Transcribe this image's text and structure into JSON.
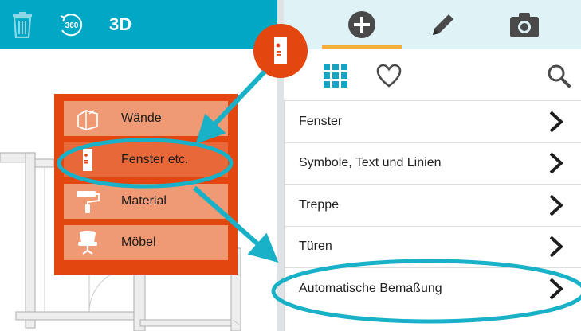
{
  "toolbar": {
    "trash_icon": "trash-icon",
    "view360_label": "360",
    "view3d_label": "3D"
  },
  "right_panel": {
    "tabs": [
      {
        "icon": "plus-circle-icon",
        "active": true
      },
      {
        "icon": "pencil-icon",
        "active": false
      },
      {
        "icon": "camera-icon",
        "active": false
      }
    ],
    "sub_icons": [
      "grid-icon",
      "heart-icon",
      "search-icon"
    ],
    "categories": [
      {
        "label": "Fenster"
      },
      {
        "label": "Symbole, Text und Linien"
      },
      {
        "label": "Treppe"
      },
      {
        "label": "Türen"
      },
      {
        "label": "Automatische Bemaßung"
      }
    ]
  },
  "mode_menu": {
    "items": [
      {
        "label": "Wände",
        "icon": "wall-icon"
      },
      {
        "label": "Fenster etc.",
        "icon": "window-door-icon",
        "active": true
      },
      {
        "label": "Material",
        "icon": "paint-roller-icon"
      },
      {
        "label": "Möbel",
        "icon": "chair-icon"
      }
    ]
  },
  "colors": {
    "top_bar": "#00a8c6",
    "accent_orange": "#e4460f",
    "annotation_teal": "#18b1c7",
    "active_tab_underline": "#f6b03a"
  }
}
